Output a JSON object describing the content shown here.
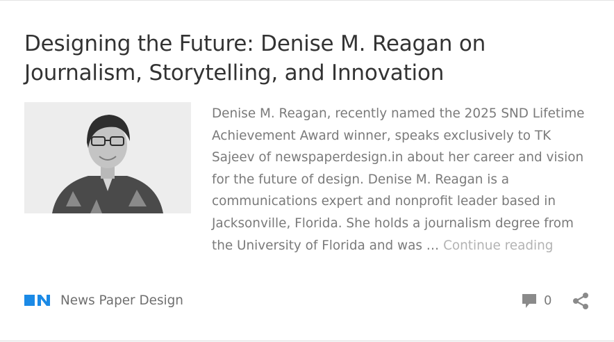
{
  "post": {
    "title": "Designing the Future: Denise M. Reagan on Journalism, Storytelling, and Innovation",
    "excerpt": "Denise M. Reagan, recently named the 2025 SND Lifetime Achievement Award winner, speaks exclusively to TK Sajeev of newspaperdesign.in about her career and vision for the future of design. Denise M. Reagan is a communications expert and nonprofit leader based in Jacksonville, Florida. She holds a journalism degree from the University of Florida and was …",
    "continue_label": "Continue reading",
    "author_name": "News Paper Design",
    "comment_count": "0"
  },
  "icons": {
    "logo": "newspaper-design-logo",
    "comment": "comment-bubble-icon",
    "share": "share-icon"
  },
  "colors": {
    "logo_blue": "#1b8ae6",
    "title": "#333333",
    "excerpt": "#7a7a7a",
    "continue_link": "#b3b3b3",
    "icon_gray": "#8a8a8a"
  }
}
